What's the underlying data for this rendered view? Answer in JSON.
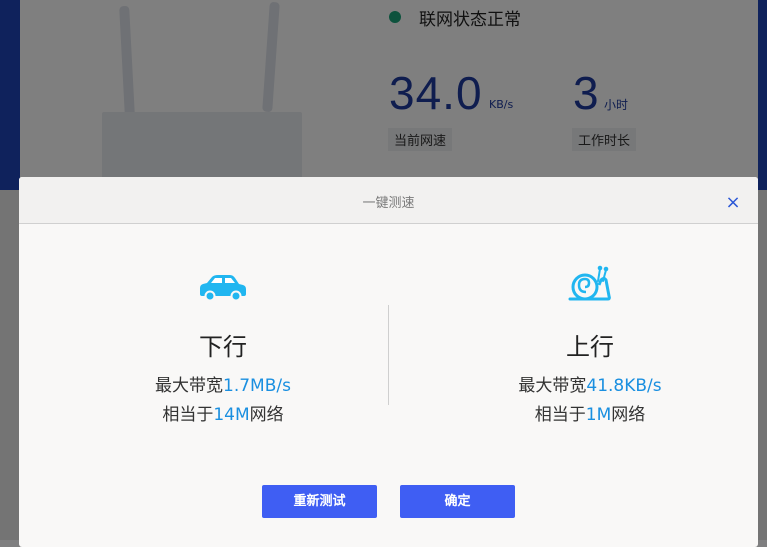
{
  "background": {
    "status_text": "联网状态正常",
    "speed": {
      "value": "34.0",
      "unit": "KB/s",
      "label": "当前网速"
    },
    "uptime": {
      "value": "3",
      "unit": "小时",
      "label": "工作时长"
    }
  },
  "modal": {
    "title": "一键测速",
    "close_symbol": "×",
    "download": {
      "title": "下行",
      "bandwidth_prefix": "最大带宽",
      "bandwidth_value": "1.7MB/s",
      "equiv_prefix": "相当于",
      "equiv_value": "14M",
      "equiv_suffix": "网络",
      "icon": "car-icon"
    },
    "upload": {
      "title": "上行",
      "bandwidth_prefix": "最大带宽",
      "bandwidth_value": "41.8KB/s",
      "equiv_prefix": "相当于",
      "equiv_value": "1M",
      "equiv_suffix": "网络",
      "icon": "snail-icon"
    },
    "buttons": {
      "retest": "重新测试",
      "confirm": "确定"
    }
  },
  "colors": {
    "accent": "#3f5ef3",
    "highlight": "#1a8fe0",
    "icon": "#21b6f0",
    "status": "#1aa57a"
  }
}
